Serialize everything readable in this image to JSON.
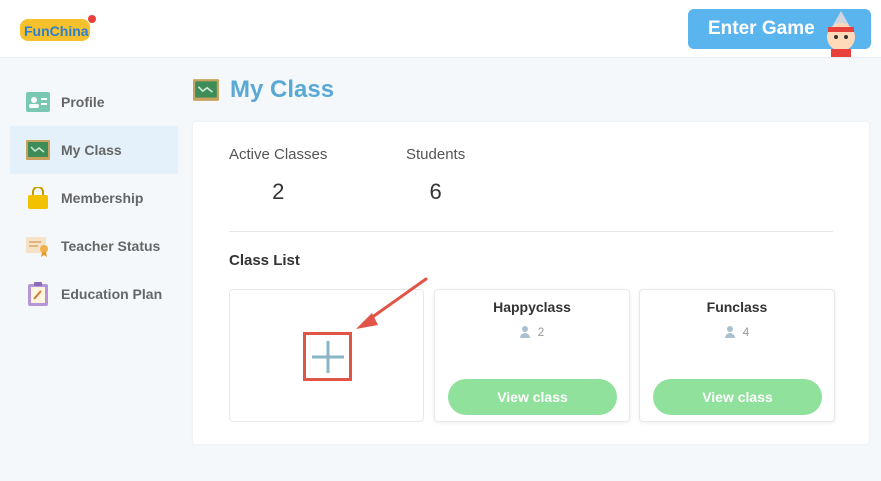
{
  "header": {
    "logo_text": "FunChina",
    "enter_game_label": "Enter Game"
  },
  "sidebar": {
    "items": [
      {
        "label": "Profile",
        "icon": "profile-card-icon",
        "active": false
      },
      {
        "label": "My Class",
        "icon": "chalkboard-icon",
        "active": true
      },
      {
        "label": "Membership",
        "icon": "shopping-bag-icon",
        "active": false
      },
      {
        "label": "Teacher Status",
        "icon": "certificate-icon",
        "active": false
      },
      {
        "label": "Education Plan",
        "icon": "clipboard-icon",
        "active": false
      }
    ]
  },
  "page": {
    "title": "My Class",
    "stats": {
      "active_classes_label": "Active Classes",
      "active_classes_value": "2",
      "students_label": "Students",
      "students_value": "6"
    },
    "class_list_title": "Class List",
    "add_class": {
      "icon": "plus-icon"
    },
    "classes": [
      {
        "name": "Happyclass",
        "count": "2",
        "button_label": "View class"
      },
      {
        "name": "Funclass",
        "count": "4",
        "button_label": "View class"
      }
    ]
  },
  "colors": {
    "accent_blue": "#5ab4ee",
    "title_blue": "#5aa8d4",
    "view_button_green": "#8fe19c",
    "annotation_red": "#e05547"
  }
}
